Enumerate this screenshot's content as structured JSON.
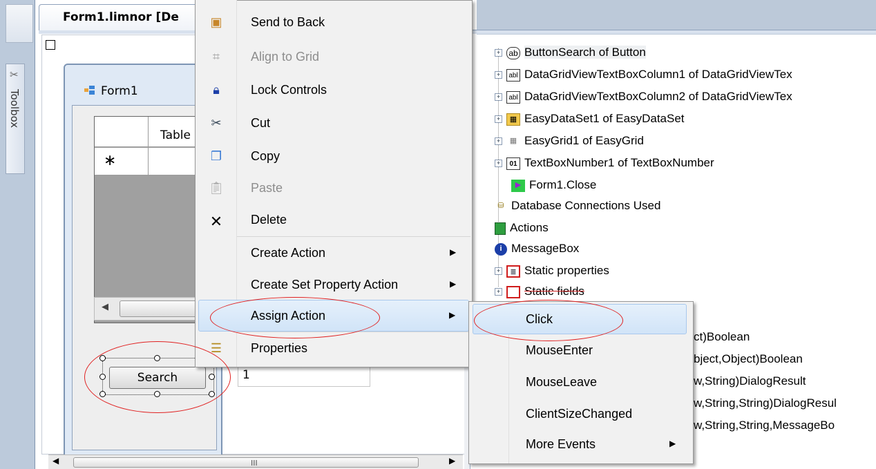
{
  "document_tab": {
    "title": "Form1.limnor [De"
  },
  "toolbox": {
    "label": "Toolbox"
  },
  "form": {
    "title": "Form1",
    "grid": {
      "column_header": "Table",
      "new_row_marker": "∗"
    },
    "search_button_label": "Search",
    "number_box_value": "1"
  },
  "context_menu": {
    "items": [
      {
        "label": "Send to Back",
        "icon": "send-to-back-icon",
        "enabled": true
      },
      {
        "label": "Align to Grid",
        "icon": "align-grid-icon",
        "enabled": false
      },
      {
        "label": "Lock Controls",
        "icon": "lock-icon",
        "enabled": true
      },
      {
        "label": "Cut",
        "icon": "scissors-icon",
        "enabled": true
      },
      {
        "label": "Copy",
        "icon": "copy-icon",
        "enabled": true
      },
      {
        "label": "Paste",
        "icon": "paste-icon",
        "enabled": false
      },
      {
        "label": "Delete",
        "icon": "delete-icon",
        "enabled": true
      },
      {
        "label": "Create Action",
        "has_submenu": true
      },
      {
        "label": "Create Set Property Action",
        "has_submenu": true
      },
      {
        "label": "Assign Action",
        "has_submenu": true,
        "highlighted": true
      },
      {
        "label": "Properties",
        "icon": "properties-icon",
        "enabled": true
      }
    ]
  },
  "submenu": {
    "items": [
      {
        "label": "Click",
        "highlighted": true
      },
      {
        "label": "MouseEnter"
      },
      {
        "label": "MouseLeave"
      },
      {
        "label": "ClientSizeChanged"
      },
      {
        "label": "More Events",
        "has_submenu": true
      }
    ]
  },
  "tree": {
    "items": [
      {
        "label": "ButtonSearch of Button",
        "icon": "button-ab-icon"
      },
      {
        "label": "DataGridViewTextBoxColumn1 of DataGridViewTex",
        "icon": "textbox-abl-icon"
      },
      {
        "label": "DataGridViewTextBoxColumn2 of DataGridViewTex",
        "icon": "textbox-abl-icon"
      },
      {
        "label": "EasyDataSet1 of EasyDataSet",
        "icon": "dataset-icon"
      },
      {
        "label": "EasyGrid1 of EasyGrid",
        "icon": "grid-icon"
      },
      {
        "label": "TextBoxNumber1 of TextBoxNumber",
        "icon": "number-box-icon"
      },
      {
        "label": "Form1.Close",
        "icon": "action-arrow-icon"
      },
      {
        "label": "Database Connections Used",
        "icon": "database-icon"
      },
      {
        "label": "Actions",
        "icon": "actions-icon"
      },
      {
        "label": "MessageBox",
        "icon": "info-icon"
      },
      {
        "label": "Static properties",
        "icon": "static-properties-icon"
      },
      {
        "label": "Static fields",
        "icon": "static-fields-icon"
      }
    ],
    "partial_methods": [
      "ct)Boolean",
      "bject,Object)Boolean",
      "w,String)DialogResult",
      "w,String,String)DialogResul",
      "w,String,String,MessageBo"
    ]
  },
  "colors": {
    "annotation_red": "#e02020",
    "menu_highlight": "#d1e4f8"
  }
}
